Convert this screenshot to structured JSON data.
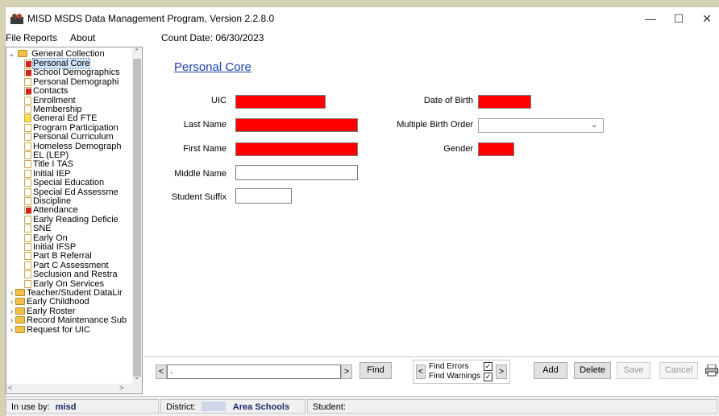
{
  "window": {
    "title": "MISD MSDS Data Management Program,  Version 2.2.8.0",
    "controls": {
      "minimize": "—",
      "maximize": "☐",
      "close": "✕"
    }
  },
  "menu": {
    "items": [
      "File",
      "Reports",
      "About"
    ],
    "count_date": "Count Date: 06/30/2023"
  },
  "tree": {
    "root": "General Collection",
    "items": [
      {
        "label": "Personal Core",
        "icon": "red"
      },
      {
        "label": "School Demographics",
        "icon": "red"
      },
      {
        "label": "Personal Demographi",
        "icon": "doc"
      },
      {
        "label": "Contacts",
        "icon": "red"
      },
      {
        "label": "Enrollment",
        "icon": "doc"
      },
      {
        "label": "Membership",
        "icon": "doc"
      },
      {
        "label": "General Ed FTE",
        "icon": "yellow"
      },
      {
        "label": "Program Participation",
        "icon": "doc"
      },
      {
        "label": "Personal Curriculum",
        "icon": "doc"
      },
      {
        "label": "Homeless Demograph",
        "icon": "doc"
      },
      {
        "label": "EL (LEP)",
        "icon": "doc"
      },
      {
        "label": "Title I TAS",
        "icon": "doc"
      },
      {
        "label": "Initial IEP",
        "icon": "doc"
      },
      {
        "label": "Special Education",
        "icon": "doc"
      },
      {
        "label": "Special Ed Assessme",
        "icon": "doc"
      },
      {
        "label": "Discipline",
        "icon": "doc"
      },
      {
        "label": "Attendance",
        "icon": "red"
      },
      {
        "label": "Early Reading Deficie",
        "icon": "doc"
      },
      {
        "label": "SNE",
        "icon": "doc"
      },
      {
        "label": "Early On",
        "icon": "doc"
      },
      {
        "label": "Initial IFSP",
        "icon": "doc"
      },
      {
        "label": "Part B Referral",
        "icon": "doc"
      },
      {
        "label": "Part C Assessment",
        "icon": "doc"
      },
      {
        "label": "Seclusion and Restra",
        "icon": "doc"
      },
      {
        "label": "Early On Services",
        "icon": "doc"
      }
    ],
    "folders": [
      "Teacher/Student DataLir",
      "Early Childhood",
      "Early Roster",
      "Record Maintenance Sub",
      "Request for UIC"
    ]
  },
  "form": {
    "heading": "Personal Core",
    "labels": {
      "uic": "UIC",
      "last_name": "Last Name",
      "first_name": "First Name",
      "middle_name": "Middle Name",
      "student_suffix": "Student Suffix",
      "dob": "Date of Birth",
      "multiple_birth": "Multiple Birth Order",
      "gender": "Gender"
    },
    "values": {
      "search": "."
    }
  },
  "bottombar": {
    "find": "Find",
    "find_errors": "Find Errors",
    "find_warnings": "Find Warnings",
    "find_errors_checked": true,
    "find_warnings_checked": true,
    "add": "Add",
    "delete": "Delete",
    "save": "Save",
    "cancel": "Cancel"
  },
  "status": {
    "in_use_label": "In use by:",
    "in_use_user": "misd",
    "district_label": "District:",
    "district_value": "Area Schools",
    "student_label": "Student:"
  },
  "colors": {
    "required_field": "#ff0000",
    "heading": "#1a3ea8"
  }
}
